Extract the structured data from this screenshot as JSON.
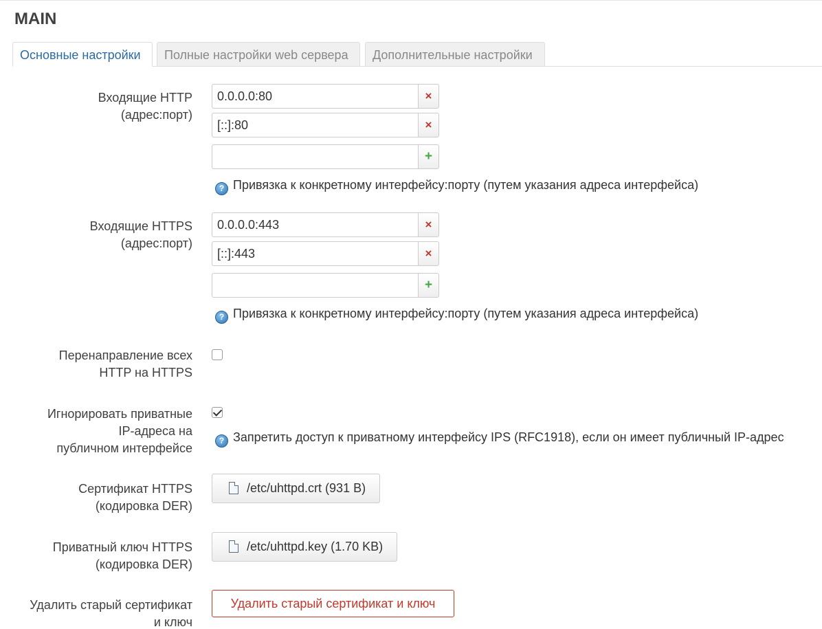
{
  "section": {
    "title": "MAIN"
  },
  "tabs": [
    {
      "label": "Основные настройки",
      "active": true
    },
    {
      "label": "Полные настройки web сервера",
      "active": false
    },
    {
      "label": "Дополнительные настройки",
      "active": false
    }
  ],
  "http": {
    "label_line1": "Входящие HTTP",
    "label_line2": "(адрес:порт)",
    "values": [
      "0.0.0.0:80",
      "[::]:80",
      ""
    ],
    "help": "Привязка к конкретному интерфейсу:порту (путем указания адреса интерфейса)"
  },
  "https": {
    "label_line1": "Входящие HTTPS",
    "label_line2": "(адрес:порт)",
    "values": [
      "0.0.0.0:443",
      "[::]:443",
      ""
    ],
    "help": "Привязка к конкретному интерфейсу:порту (путем указания адреса интерфейса)"
  },
  "redirect": {
    "label_line1": "Перенаправление всех",
    "label_line2": "HTTP на HTTPS",
    "checked": false
  },
  "ignore_private": {
    "label_line1": "Игнорировать приватные",
    "label_line2": "IP-адреса на",
    "label_line3": "публичном интерфейсе",
    "checked": true,
    "help": "Запретить доступ к приватному интерфейсу IPS (RFC1918), если он имеет публичный IP-адрес"
  },
  "cert": {
    "label_line1": "Сертификат HTTPS",
    "label_line2": "(кодировка DER)",
    "file": "/etc/uhttpd.crt (931 B)"
  },
  "key": {
    "label_line1": "Приватный ключ HTTPS",
    "label_line2": "(кодировка DER)",
    "file": "/etc/uhttpd.key (1.70 KB)"
  },
  "remove_cert": {
    "label_line1": "Удалить старый сертификат",
    "label_line2": "и ключ",
    "button": "Удалить старый сертификат и ключ"
  },
  "icons": {
    "remove": "×",
    "add": "+",
    "help": "?"
  },
  "colors": {
    "active_tab": "#2a6aa0",
    "remove": "#c0392b",
    "add": "#45a845",
    "danger": "#c0392b"
  }
}
